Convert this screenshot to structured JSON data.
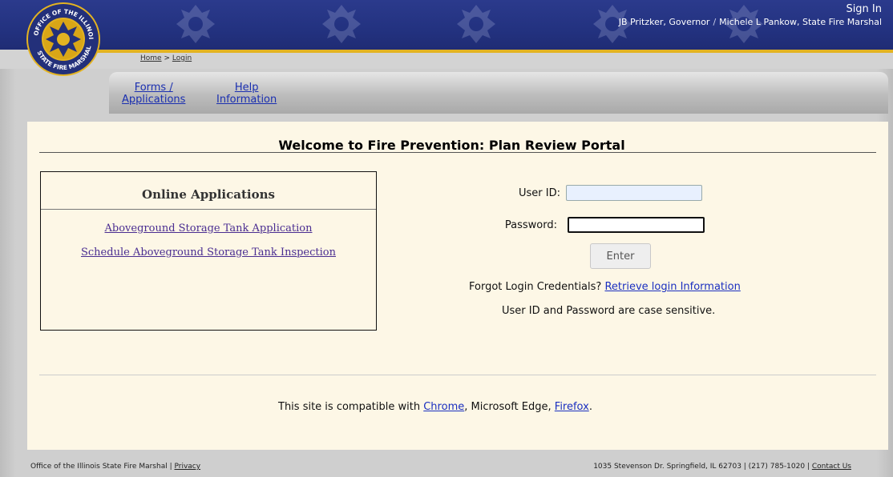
{
  "header": {
    "sign_in": "Sign In",
    "governor": "JB Pritzker, Governor",
    "separator": "/",
    "marshal": "Michele L Pankow, State Fire Marshal",
    "seal_text": "OFFICE OF THE ILLINOIS · STATE FIRE MARSHAL",
    "colors": {
      "header_blue": "#233280",
      "gold": "#e3b321"
    }
  },
  "breadcrumb": {
    "home": "Home",
    "separator": ">",
    "current": "Login"
  },
  "nav": {
    "forms_line1": "Forms /",
    "forms_line2": "Applications",
    "help_line1": "Help",
    "help_line2": "Information"
  },
  "main": {
    "welcome": "Welcome to Fire Prevention: Plan Review Portal",
    "apps": {
      "title": "Online Applications",
      "links": [
        "Aboveground Storage Tank Application",
        "Schedule Aboveground Storage Tank Inspection"
      ]
    },
    "login": {
      "userid_label": "User ID:",
      "password_label": "Password:",
      "userid_value": "",
      "password_value": "",
      "enter_label": "Enter",
      "forgot_text": "Forgot Login Credentials?",
      "forgot_link": "Retrieve login Information",
      "case_note": "User ID and Password are case sensitive."
    },
    "compat": {
      "prefix": "This site is compatible with",
      "chrome": "Chrome",
      "middle": ", Microsoft Edge,",
      "firefox": "Firefox",
      "suffix": "."
    }
  },
  "footer": {
    "office": "Office of the Illinois State Fire Marshal |",
    "privacy": "Privacy",
    "address": "1035 Stevenson Dr. Springfield, IL 62703 | (217) 785-1020 |",
    "contact": "Contact Us"
  }
}
